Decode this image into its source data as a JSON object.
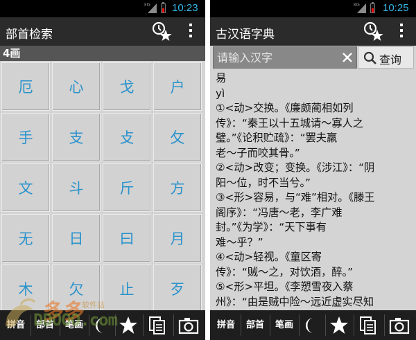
{
  "colors": {
    "accent": "#33b5e5",
    "grid_text": "#2a93cc",
    "action_bar": "#2b2b2b",
    "bottom_bar": "#1e1e1e",
    "section_header": "#555555"
  },
  "left": {
    "status": {
      "network": "3G",
      "time": "10:23"
    },
    "title": "部首检索",
    "section": "4画",
    "radicals": [
      "厄",
      "心",
      "戈",
      "户",
      "手",
      "支",
      "攴",
      "攵",
      "文",
      "斗",
      "斤",
      "方",
      "无",
      "日",
      "曰",
      "月",
      "木",
      "欠",
      "止",
      "歹"
    ],
    "tabs": [
      "拼音",
      "部首",
      "笔画"
    ],
    "icons": [
      "moon-icon",
      "star-icon",
      "copy-icon",
      "camera-icon"
    ]
  },
  "right": {
    "status": {
      "network": "3G",
      "time": "10:25"
    },
    "title": "古汉语字典",
    "search": {
      "placeholder": "请输入汉字",
      "button_label": "查询"
    },
    "entry": {
      "char": "易",
      "pinyin": "yì",
      "lines": [
        "①<动>交换。《廉颇蔺相如列",
        "传》：“秦王以十五城请～寡人之",
        "璧。”《论积贮疏》：“罢夫羸",
        "老～子而咬其骨。”",
        "②<动>改变；变换。《涉江》：“阴",
        "阳～位，时不当兮。”",
        "③<形>容易，与“难”相对。《滕王",
        "阁序》：“冯唐～老，李广难",
        "封。”《为学》：“天下事有",
        "难～乎？”",
        "④<动>轻视。《童区寄",
        "传》：“贼～之，对饮酒，醉。”",
        "⑤<形>平坦。《李愬雪夜入蔡",
        "州》：“由是贼中险～远近虚实尽知"
      ]
    },
    "tabs": [
      "拼音",
      "部首",
      "笔画"
    ],
    "icons": [
      "moon-icon",
      "star-icon",
      "copy-icon",
      "camera-icon"
    ]
  },
  "watermark": {
    "chars": "多多",
    "site": "软件站",
    "url": "DDOOO.com"
  }
}
